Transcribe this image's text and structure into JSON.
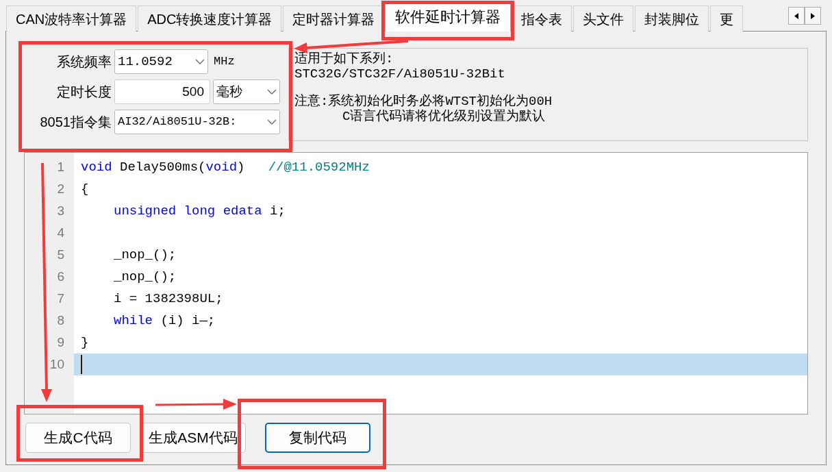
{
  "tabs": [
    {
      "label": "CAN波特率计算器",
      "selected": false
    },
    {
      "label": "ADC转换速度计算器",
      "selected": false
    },
    {
      "label": "定时器计算器",
      "selected": false
    },
    {
      "label": "软件延时计算器",
      "selected": true
    },
    {
      "label": "指令表",
      "selected": false
    },
    {
      "label": "头文件",
      "selected": false
    },
    {
      "label": "封装脚位",
      "selected": false
    },
    {
      "label": "更",
      "selected": false
    }
  ],
  "settings": [
    {
      "kind": "select",
      "label": "系统频率",
      "value": "11.0592",
      "unit": "MHz"
    },
    {
      "kind": "input-select",
      "label": "定时长度",
      "value": "500",
      "option": "毫秒"
    },
    {
      "kind": "select-wide",
      "label": "8051指令集",
      "value": "AI32/Ai8051U-32B:"
    }
  ],
  "info": [
    {
      "lines": [
        {
          "text": "适用于如下系列:",
          "indented": false
        },
        {
          "text": "STC32G/STC32F/Ai8051U-32Bit",
          "indented": false
        }
      ]
    },
    {
      "lines": [
        {
          "text": "注意:系统初始化时务必将WTST初始化为00H",
          "indented": false
        },
        {
          "text": "C语言代码请将优化级别设置为默认",
          "indented": true
        }
      ]
    }
  ],
  "code": [
    {
      "number": "1",
      "indented": false,
      "current": false,
      "tokens": [
        {
          "text": "void",
          "kind": "keyword"
        },
        {
          "text": " Delay500ms(",
          "kind": "plain"
        },
        {
          "text": "void",
          "kind": "keyword"
        },
        {
          "text": ")   ",
          "kind": "plain"
        },
        {
          "text": "//@11.0592MHz",
          "kind": "comment"
        }
      ]
    },
    {
      "number": "2",
      "indented": false,
      "current": false,
      "tokens": [
        {
          "text": "{",
          "kind": "plain"
        }
      ]
    },
    {
      "number": "3",
      "indented": true,
      "current": false,
      "tokens": [
        {
          "text": "unsigned long edata",
          "kind": "keyword"
        },
        {
          "text": " i;",
          "kind": "plain"
        }
      ]
    },
    {
      "number": "4",
      "current": false
    },
    {
      "number": "5",
      "indented": true,
      "current": false,
      "tokens": [
        {
          "text": "_nop_();",
          "kind": "plain"
        }
      ]
    },
    {
      "number": "6",
      "indented": true,
      "current": false,
      "tokens": [
        {
          "text": "_nop_();",
          "kind": "plain"
        }
      ]
    },
    {
      "number": "7",
      "indented": true,
      "current": false,
      "tokens": [
        {
          "text": "i = 1382398UL;",
          "kind": "plain"
        }
      ]
    },
    {
      "number": "8",
      "indented": true,
      "current": false,
      "tokens": [
        {
          "text": "while",
          "kind": "keyword"
        },
        {
          "text": " (i) i—;",
          "kind": "plain"
        }
      ]
    },
    {
      "number": "9",
      "indented": false,
      "current": false,
      "tokens": [
        {
          "text": "}",
          "kind": "plain"
        }
      ]
    },
    {
      "number": "10",
      "indented": false,
      "current": true
    }
  ],
  "buttons": [
    {
      "label": "生成C代码",
      "focused": false
    },
    {
      "label": "生成ASM代码",
      "focused": false
    },
    {
      "label": "复制代码",
      "focused": true
    }
  ]
}
